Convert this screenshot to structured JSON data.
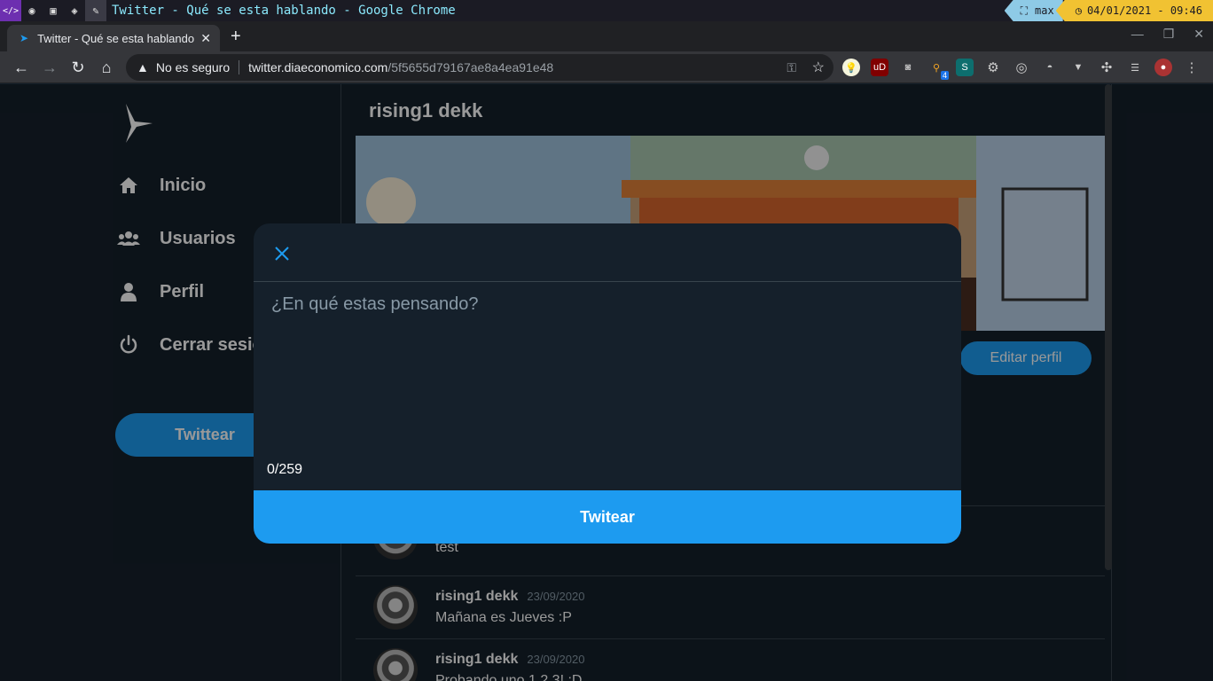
{
  "os": {
    "window_title": "Twitter - Qué se esta hablando - Google Chrome",
    "layout_mode": "max",
    "clock": "04/01/2021 - 09:46",
    "workspace_icons": [
      "code-icon",
      "chrome-icon",
      "terminal-icon",
      "layers-icon",
      "edit-icon"
    ]
  },
  "browser": {
    "tab_title": "Twitter - Qué se esta hablando",
    "new_tab": "+",
    "insecure_label": "No es seguro",
    "url_host": "twitter.diaeconomico.com",
    "url_path": "/5f5655d79167ae8a4ea91e48",
    "extension_badge": "4"
  },
  "sidebar": {
    "items": [
      {
        "label": "Inicio",
        "icon": "home-icon"
      },
      {
        "label": "Usuarios",
        "icon": "users-icon"
      },
      {
        "label": "Perfil",
        "icon": "user-icon"
      },
      {
        "label": "Cerrar sesión",
        "icon": "power-icon"
      }
    ],
    "tweet_button": "Twittear"
  },
  "profile": {
    "name": "rising1 dekk",
    "edit_button": "Editar perfil"
  },
  "tweets": [
    {
      "author": "",
      "date": "",
      "text": "test"
    },
    {
      "author": "rising1 dekk",
      "date": "23/09/2020",
      "text": "Mañana es Jueves :P"
    },
    {
      "author": "rising1 dekk",
      "date": "23/09/2020",
      "text": "Probando uno 1,2,3! :D"
    }
  ],
  "modal": {
    "placeholder": "¿En qué estas pensando?",
    "counter": "0/259",
    "submit_label": "Twitear"
  },
  "colors": {
    "accent": "#1d9bf0",
    "background": "#15202b",
    "border": "#38444d"
  }
}
